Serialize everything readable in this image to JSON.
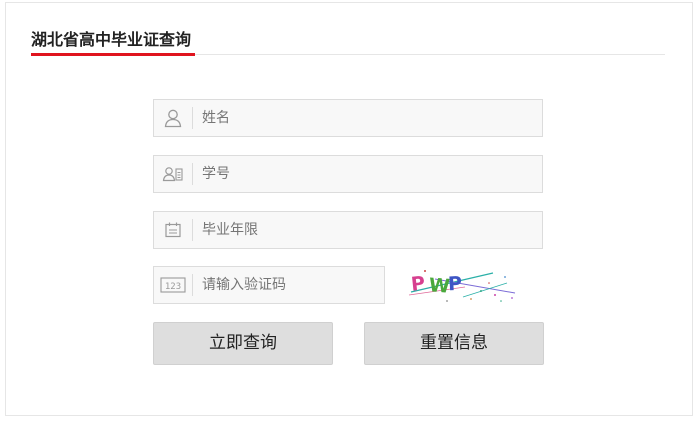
{
  "form": {
    "title": "湖北省高中毕业证查询",
    "fields": {
      "name": {
        "placeholder": "姓名",
        "icon": "user-icon"
      },
      "student_id": {
        "placeholder": "学号",
        "icon": "id-card-icon"
      },
      "graduation_year": {
        "placeholder": "毕业年限",
        "icon": "calendar-icon"
      },
      "captcha": {
        "placeholder": "请输入验证码",
        "icon": "number-123-icon"
      }
    },
    "captcha_text": "PWP",
    "buttons": {
      "query": "立即查询",
      "reset": "重置信息"
    }
  },
  "colors": {
    "accent": "#e0141e",
    "field_bg": "#f8f8f8",
    "button_bg": "#dedede"
  }
}
